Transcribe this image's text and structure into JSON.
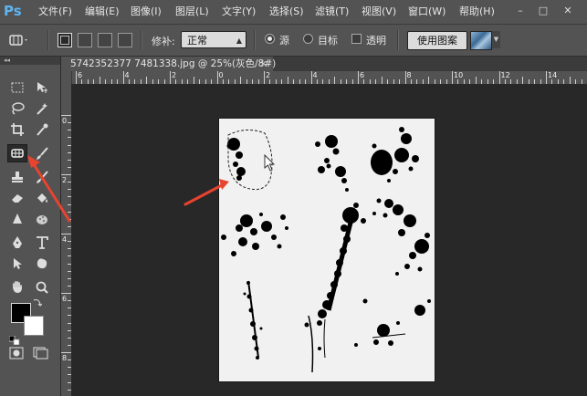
{
  "app": {
    "logo": "Ps"
  },
  "menubar": {
    "items": [
      "文件(F)",
      "编辑(E)",
      "图像(I)",
      "图层(L)",
      "文字(Y)",
      "选择(S)",
      "滤镜(T)",
      "视图(V)",
      "窗口(W)",
      "帮助(H)"
    ],
    "window_controls": [
      "–",
      "□",
      "✕"
    ]
  },
  "options": {
    "patch_label": "修补:",
    "patch_mode": "正常",
    "source_label": "源",
    "target_label": "目标",
    "transparent_label": "透明",
    "use_pattern_label": "使用图案",
    "selected_mode": "source"
  },
  "document": {
    "tab_title": "5742352377 7481338.jpg @ 25%(灰色/8#)",
    "tab_close": "×"
  },
  "rulers": {
    "horizontal": [
      "6",
      "4",
      "2",
      "0",
      "2",
      "4",
      "6",
      "8",
      "10",
      "12",
      "14"
    ],
    "vertical": [
      "0",
      "2",
      "4",
      "6",
      "8"
    ]
  },
  "toolbox": {
    "collapse_glyph": "◂◂",
    "tools": [
      [
        "marquee-tool",
        "move-tool"
      ],
      [
        "lasso-tool",
        "magic-wand-tool"
      ],
      [
        "crop-tool",
        "eyedropper-tool"
      ],
      [
        "patch-tool",
        "brush-tool"
      ],
      [
        "clone-stamp-tool",
        "history-brush-tool"
      ],
      [
        "eraser-tool",
        "paint-bucket-tool"
      ],
      [
        "blur-tool",
        "dodge-tool"
      ],
      [
        "pen-tool",
        "type-tool"
      ],
      [
        "path-selection-tool",
        "shape-tool"
      ],
      [
        "hand-tool",
        "zoom-tool"
      ]
    ],
    "selected_tool": "patch-tool"
  },
  "colors": {
    "foreground": "#000000",
    "background": "#ffffff",
    "accent": "#e8432e"
  }
}
